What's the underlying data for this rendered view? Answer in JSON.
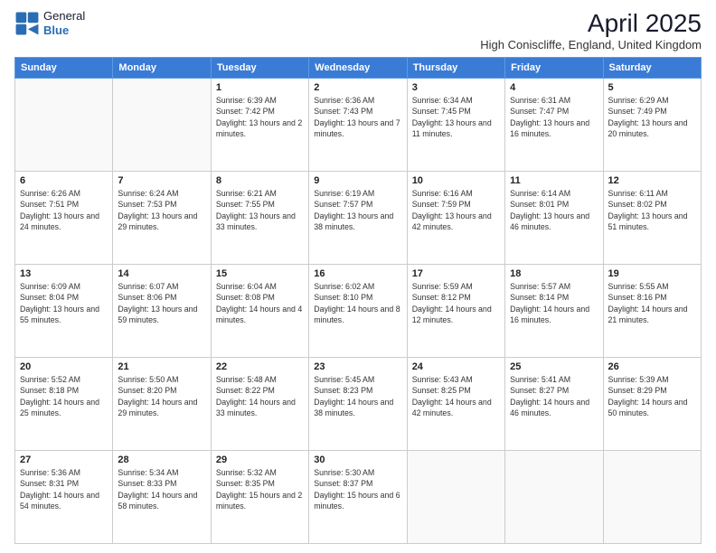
{
  "header": {
    "logo_general": "General",
    "logo_blue": "Blue",
    "month_title": "April 2025",
    "location": "High Coniscliffe, England, United Kingdom"
  },
  "days_of_week": [
    "Sunday",
    "Monday",
    "Tuesday",
    "Wednesday",
    "Thursday",
    "Friday",
    "Saturday"
  ],
  "weeks": [
    [
      {
        "day": "",
        "info": ""
      },
      {
        "day": "",
        "info": ""
      },
      {
        "day": "1",
        "info": "Sunrise: 6:39 AM\nSunset: 7:42 PM\nDaylight: 13 hours and 2 minutes."
      },
      {
        "day": "2",
        "info": "Sunrise: 6:36 AM\nSunset: 7:43 PM\nDaylight: 13 hours and 7 minutes."
      },
      {
        "day": "3",
        "info": "Sunrise: 6:34 AM\nSunset: 7:45 PM\nDaylight: 13 hours and 11 minutes."
      },
      {
        "day": "4",
        "info": "Sunrise: 6:31 AM\nSunset: 7:47 PM\nDaylight: 13 hours and 16 minutes."
      },
      {
        "day": "5",
        "info": "Sunrise: 6:29 AM\nSunset: 7:49 PM\nDaylight: 13 hours and 20 minutes."
      }
    ],
    [
      {
        "day": "6",
        "info": "Sunrise: 6:26 AM\nSunset: 7:51 PM\nDaylight: 13 hours and 24 minutes."
      },
      {
        "day": "7",
        "info": "Sunrise: 6:24 AM\nSunset: 7:53 PM\nDaylight: 13 hours and 29 minutes."
      },
      {
        "day": "8",
        "info": "Sunrise: 6:21 AM\nSunset: 7:55 PM\nDaylight: 13 hours and 33 minutes."
      },
      {
        "day": "9",
        "info": "Sunrise: 6:19 AM\nSunset: 7:57 PM\nDaylight: 13 hours and 38 minutes."
      },
      {
        "day": "10",
        "info": "Sunrise: 6:16 AM\nSunset: 7:59 PM\nDaylight: 13 hours and 42 minutes."
      },
      {
        "day": "11",
        "info": "Sunrise: 6:14 AM\nSunset: 8:01 PM\nDaylight: 13 hours and 46 minutes."
      },
      {
        "day": "12",
        "info": "Sunrise: 6:11 AM\nSunset: 8:02 PM\nDaylight: 13 hours and 51 minutes."
      }
    ],
    [
      {
        "day": "13",
        "info": "Sunrise: 6:09 AM\nSunset: 8:04 PM\nDaylight: 13 hours and 55 minutes."
      },
      {
        "day": "14",
        "info": "Sunrise: 6:07 AM\nSunset: 8:06 PM\nDaylight: 13 hours and 59 minutes."
      },
      {
        "day": "15",
        "info": "Sunrise: 6:04 AM\nSunset: 8:08 PM\nDaylight: 14 hours and 4 minutes."
      },
      {
        "day": "16",
        "info": "Sunrise: 6:02 AM\nSunset: 8:10 PM\nDaylight: 14 hours and 8 minutes."
      },
      {
        "day": "17",
        "info": "Sunrise: 5:59 AM\nSunset: 8:12 PM\nDaylight: 14 hours and 12 minutes."
      },
      {
        "day": "18",
        "info": "Sunrise: 5:57 AM\nSunset: 8:14 PM\nDaylight: 14 hours and 16 minutes."
      },
      {
        "day": "19",
        "info": "Sunrise: 5:55 AM\nSunset: 8:16 PM\nDaylight: 14 hours and 21 minutes."
      }
    ],
    [
      {
        "day": "20",
        "info": "Sunrise: 5:52 AM\nSunset: 8:18 PM\nDaylight: 14 hours and 25 minutes."
      },
      {
        "day": "21",
        "info": "Sunrise: 5:50 AM\nSunset: 8:20 PM\nDaylight: 14 hours and 29 minutes."
      },
      {
        "day": "22",
        "info": "Sunrise: 5:48 AM\nSunset: 8:22 PM\nDaylight: 14 hours and 33 minutes."
      },
      {
        "day": "23",
        "info": "Sunrise: 5:45 AM\nSunset: 8:23 PM\nDaylight: 14 hours and 38 minutes."
      },
      {
        "day": "24",
        "info": "Sunrise: 5:43 AM\nSunset: 8:25 PM\nDaylight: 14 hours and 42 minutes."
      },
      {
        "day": "25",
        "info": "Sunrise: 5:41 AM\nSunset: 8:27 PM\nDaylight: 14 hours and 46 minutes."
      },
      {
        "day": "26",
        "info": "Sunrise: 5:39 AM\nSunset: 8:29 PM\nDaylight: 14 hours and 50 minutes."
      }
    ],
    [
      {
        "day": "27",
        "info": "Sunrise: 5:36 AM\nSunset: 8:31 PM\nDaylight: 14 hours and 54 minutes."
      },
      {
        "day": "28",
        "info": "Sunrise: 5:34 AM\nSunset: 8:33 PM\nDaylight: 14 hours and 58 minutes."
      },
      {
        "day": "29",
        "info": "Sunrise: 5:32 AM\nSunset: 8:35 PM\nDaylight: 15 hours and 2 minutes."
      },
      {
        "day": "30",
        "info": "Sunrise: 5:30 AM\nSunset: 8:37 PM\nDaylight: 15 hours and 6 minutes."
      },
      {
        "day": "",
        "info": ""
      },
      {
        "day": "",
        "info": ""
      },
      {
        "day": "",
        "info": ""
      }
    ]
  ]
}
